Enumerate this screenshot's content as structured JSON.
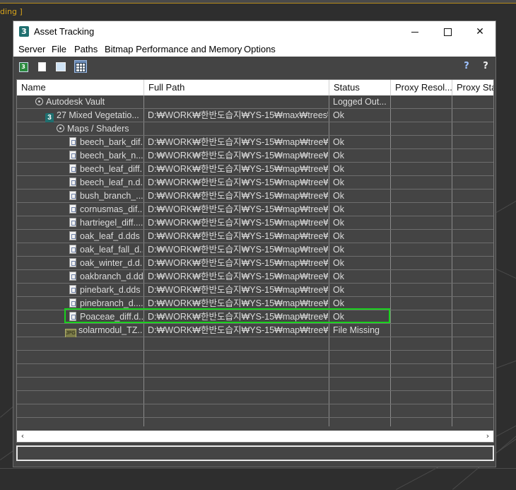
{
  "background": {
    "top_label": "ding ]"
  },
  "window": {
    "icon": "3",
    "title": "Asset Tracking",
    "minimize": "minimize",
    "maximize": "maximize",
    "close": "✕"
  },
  "menu": [
    "Server",
    "File",
    "Paths",
    "Bitmap Performance and Memory",
    "Options"
  ],
  "toolbar": {
    "buttons": [
      "refresh-icon",
      "list-view-icon",
      "tree-view-icon",
      "table-view-icon"
    ],
    "help": "?",
    "highlight_help": "?"
  },
  "columns": [
    "Name",
    "Full Path",
    "Status",
    "Proxy Resol...",
    "Proxy Stat"
  ],
  "rows": [
    {
      "name": "Autodesk Vault",
      "icon": "vault",
      "path": "",
      "status": "Logged Out..."
    },
    {
      "name": "27 Mixed Vegetatio...",
      "icon": "max",
      "path": "D:₩WORK₩한반도습지₩YS-15₩max₩trees₩",
      "status": "Ok"
    },
    {
      "name": "Maps / Shaders",
      "icon": "vault",
      "path": "",
      "status": ""
    },
    {
      "name": "beech_bark_dif...",
      "icon": "doc",
      "path": "D:₩WORK₩한반도습지₩YS-15₩map₩tree₩",
      "status": "Ok"
    },
    {
      "name": "beech_bark_n....",
      "icon": "doc",
      "path": "D:₩WORK₩한반도습지₩YS-15₩map₩tree₩",
      "status": "Ok"
    },
    {
      "name": "beech_leaf_diff...",
      "icon": "doc",
      "path": "D:₩WORK₩한반도습지₩YS-15₩map₩tree₩",
      "status": "Ok"
    },
    {
      "name": "beech_leaf_n.d...",
      "icon": "doc",
      "path": "D:₩WORK₩한반도습지₩YS-15₩map₩tree₩",
      "status": "Ok"
    },
    {
      "name": "bush_branch_...",
      "icon": "doc",
      "path": "D:₩WORK₩한반도습지₩YS-15₩map₩tree₩",
      "status": "Ok"
    },
    {
      "name": "cornusmas_dif...",
      "icon": "doc",
      "path": "D:₩WORK₩한반도습지₩YS-15₩map₩tree₩",
      "status": "Ok"
    },
    {
      "name": "hartriegel_diff....",
      "icon": "doc",
      "path": "D:₩WORK₩한반도습지₩YS-15₩map₩tree₩",
      "status": "Ok"
    },
    {
      "name": "oak_leaf_d.dds",
      "icon": "doc",
      "path": "D:₩WORK₩한반도습지₩YS-15₩map₩tree₩",
      "status": "Ok"
    },
    {
      "name": "oak_leaf_fall_d....",
      "icon": "doc",
      "path": "D:₩WORK₩한반도습지₩YS-15₩map₩tree₩",
      "status": "Ok"
    },
    {
      "name": "oak_winter_d.d...",
      "icon": "doc",
      "path": "D:₩WORK₩한반도습지₩YS-15₩map₩tree₩",
      "status": "Ok"
    },
    {
      "name": "oakbranch_d.dd...",
      "icon": "doc",
      "path": "D:₩WORK₩한반도습지₩YS-15₩map₩tree₩",
      "status": "Ok"
    },
    {
      "name": "pinebark_d.dds",
      "icon": "doc",
      "path": "D:₩WORK₩한반도습지₩YS-15₩map₩tree₩",
      "status": "Ok"
    },
    {
      "name": "pinebranch_d....",
      "icon": "doc",
      "path": "D:₩WORK₩한반도습지₩YS-15₩map₩tree₩",
      "status": "Ok"
    },
    {
      "name": "Poaceae_diff.d...",
      "icon": "doc",
      "path": "D:₩WORK₩한반도습지₩YS-15₩map₩tree₩",
      "status": "Ok"
    },
    {
      "name": "solarmodul_TZ...",
      "icon": "missing",
      "path": "D:₩WORK₩한반도습지₩YS-15₩map₩tree₩",
      "status": "File Missing"
    }
  ],
  "empty_rows": 7,
  "missing_icon_text": "JPG",
  "scroll": {
    "left": "‹",
    "right": "›"
  },
  "colors": {
    "highlight": "#19d11d",
    "active_button": "#6a8bb8"
  }
}
